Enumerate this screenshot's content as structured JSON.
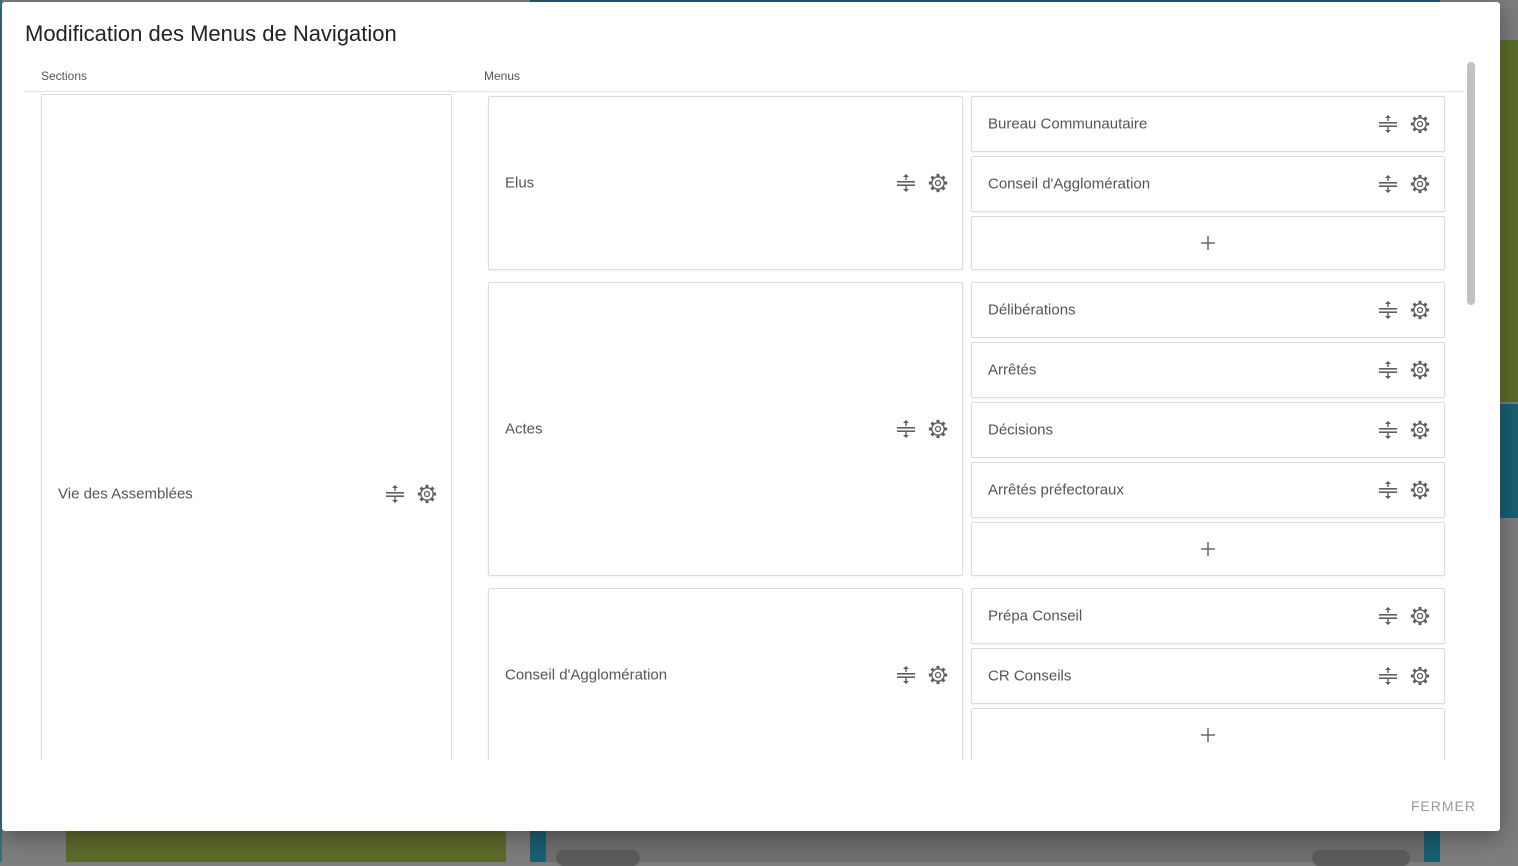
{
  "modal": {
    "title": "Modification des Menus de Navigation",
    "close_label": "FERMER"
  },
  "columns": {
    "sections_label": "Sections",
    "menus_label": "Menus"
  },
  "section": {
    "label": "Vie des Assemblées"
  },
  "menus": [
    {
      "label": "Elus",
      "submenus": [
        {
          "label": "Bureau Communautaire"
        },
        {
          "label": "Conseil d'Agglomération"
        }
      ]
    },
    {
      "label": "Actes",
      "submenus": [
        {
          "label": "Délibérations"
        },
        {
          "label": "Arrêtés"
        },
        {
          "label": "Décisions"
        },
        {
          "label": "Arrêtés préfectoraux"
        }
      ]
    },
    {
      "label": "Conseil d'Agglomération",
      "submenus": [
        {
          "label": "Prépa Conseil"
        },
        {
          "label": "CR Conseils"
        }
      ]
    }
  ],
  "icons": {
    "reorder": "reorder-icon",
    "settings": "gear-icon",
    "add": "plus-icon"
  },
  "colors": {
    "text": "#555555",
    "icon": "#5f5f5f",
    "border": "#dcdcdc",
    "overlay_green": "#5b6d2a",
    "overlay_teal": "#1b5f73"
  }
}
